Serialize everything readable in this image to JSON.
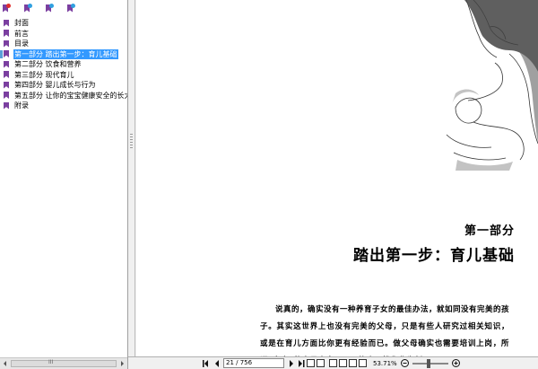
{
  "sidebar": {
    "items": [
      {
        "label": "封面",
        "selected": false
      },
      {
        "label": "前言",
        "selected": false
      },
      {
        "label": "目录",
        "selected": false
      },
      {
        "label": "第一部分 踏出第一步：育儿基础",
        "selected": true
      },
      {
        "label": "第二部分 饮食和营养",
        "selected": false
      },
      {
        "label": "第三部分 现代育儿",
        "selected": false
      },
      {
        "label": "第四部分 婴儿成长与行为",
        "selected": false
      },
      {
        "label": "第五部分 让你的宝宝健康安全的长大",
        "selected": false
      },
      {
        "label": "附录",
        "selected": false
      }
    ],
    "scroll_grip": "III"
  },
  "page": {
    "part_label": "第一部分",
    "chapter_title": "踏出第一步：育儿基础",
    "body_text": "说真的，确实没有一种养育子女的最佳办法，就如同没有完美的孩子。其实这世界上也没有完美的父母，只是有些人研究过相关知识，或是在育儿方面比你更有经验而已。做父母确实也需要培训上岗，所谓“专家”的意见太多了，可能会干扰你作为新"
  },
  "statusbar": {
    "page_value": "21 / 756",
    "zoom": "53.71%"
  },
  "colors": {
    "bookmark": "#7b3fa0",
    "selection": "#3399ff"
  }
}
